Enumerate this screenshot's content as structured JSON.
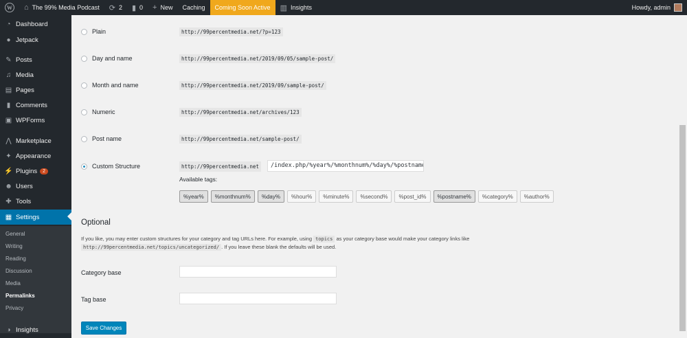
{
  "adminbar": {
    "site_name": "The 99% Media Podcast",
    "updates_count": "2",
    "comments_count": "0",
    "new_label": "New",
    "caching_label": "Caching",
    "coming_soon_label": "Coming Soon Active",
    "insights_label": "Insights",
    "howdy": "Howdy, admin",
    "accent_color": "#f0a81c"
  },
  "sidebar": {
    "items": [
      {
        "label": "Dashboard",
        "icon": "dashboard-icon"
      },
      {
        "label": "Jetpack",
        "icon": "jetpack-icon"
      },
      {
        "label": "Posts",
        "icon": "pin-icon"
      },
      {
        "label": "Media",
        "icon": "media-icon"
      },
      {
        "label": "Pages",
        "icon": "pages-icon"
      },
      {
        "label": "Comments",
        "icon": "comment-icon"
      },
      {
        "label": "WPForms",
        "icon": "forms-icon"
      },
      {
        "label": "Marketplace",
        "icon": "marketplace-icon"
      },
      {
        "label": "Appearance",
        "icon": "brush-icon"
      },
      {
        "label": "Plugins",
        "icon": "plugin-icon",
        "badge": "2"
      },
      {
        "label": "Users",
        "icon": "user-icon"
      },
      {
        "label": "Tools",
        "icon": "wrench-icon"
      },
      {
        "label": "Settings",
        "icon": "settings-icon"
      }
    ],
    "submenu": [
      "General",
      "Writing",
      "Reading",
      "Discussion",
      "Media",
      "Permalinks",
      "Privacy"
    ],
    "insights_label": "Insights",
    "active_color": "#0073aa"
  },
  "permalinks": {
    "options": [
      {
        "label": "Plain",
        "sample": "http://99percentmedia.net/?p=123"
      },
      {
        "label": "Day and name",
        "sample": "http://99percentmedia.net/2019/09/05/sample-post/"
      },
      {
        "label": "Month and name",
        "sample": "http://99percentmedia.net/2019/09/sample-post/"
      },
      {
        "label": "Numeric",
        "sample": "http://99percentmedia.net/archives/123"
      },
      {
        "label": "Post name",
        "sample": "http://99percentmedia.net/sample-post/"
      },
      {
        "label": "Custom Structure",
        "sample": "http://99percentmedia.net"
      }
    ],
    "selected": "Custom Structure",
    "custom_value": "/index.php/%year%/%monthnum%/%day%/%postname",
    "available_tags_label": "Available tags:",
    "tags": [
      "%year%",
      "%monthnum%",
      "%day%",
      "%hour%",
      "%minute%",
      "%second%",
      "%post_id%",
      "%postname%",
      "%category%",
      "%author%"
    ]
  },
  "optional": {
    "heading": "Optional",
    "desc_1": "If you like, you may enter custom structures for your category and tag URLs here. For example, using",
    "desc_code_1": "topics",
    "desc_2": "as your category base would make your category links like",
    "desc_code_2": "http://99percentmedia.net/topics/uncategorized/",
    "desc_3": ". If you leave these blank the defaults will be used.",
    "category_base_label": "Category base",
    "tag_base_label": "Tag base",
    "category_base_value": "",
    "tag_base_value": ""
  },
  "save_label": "Save Changes"
}
